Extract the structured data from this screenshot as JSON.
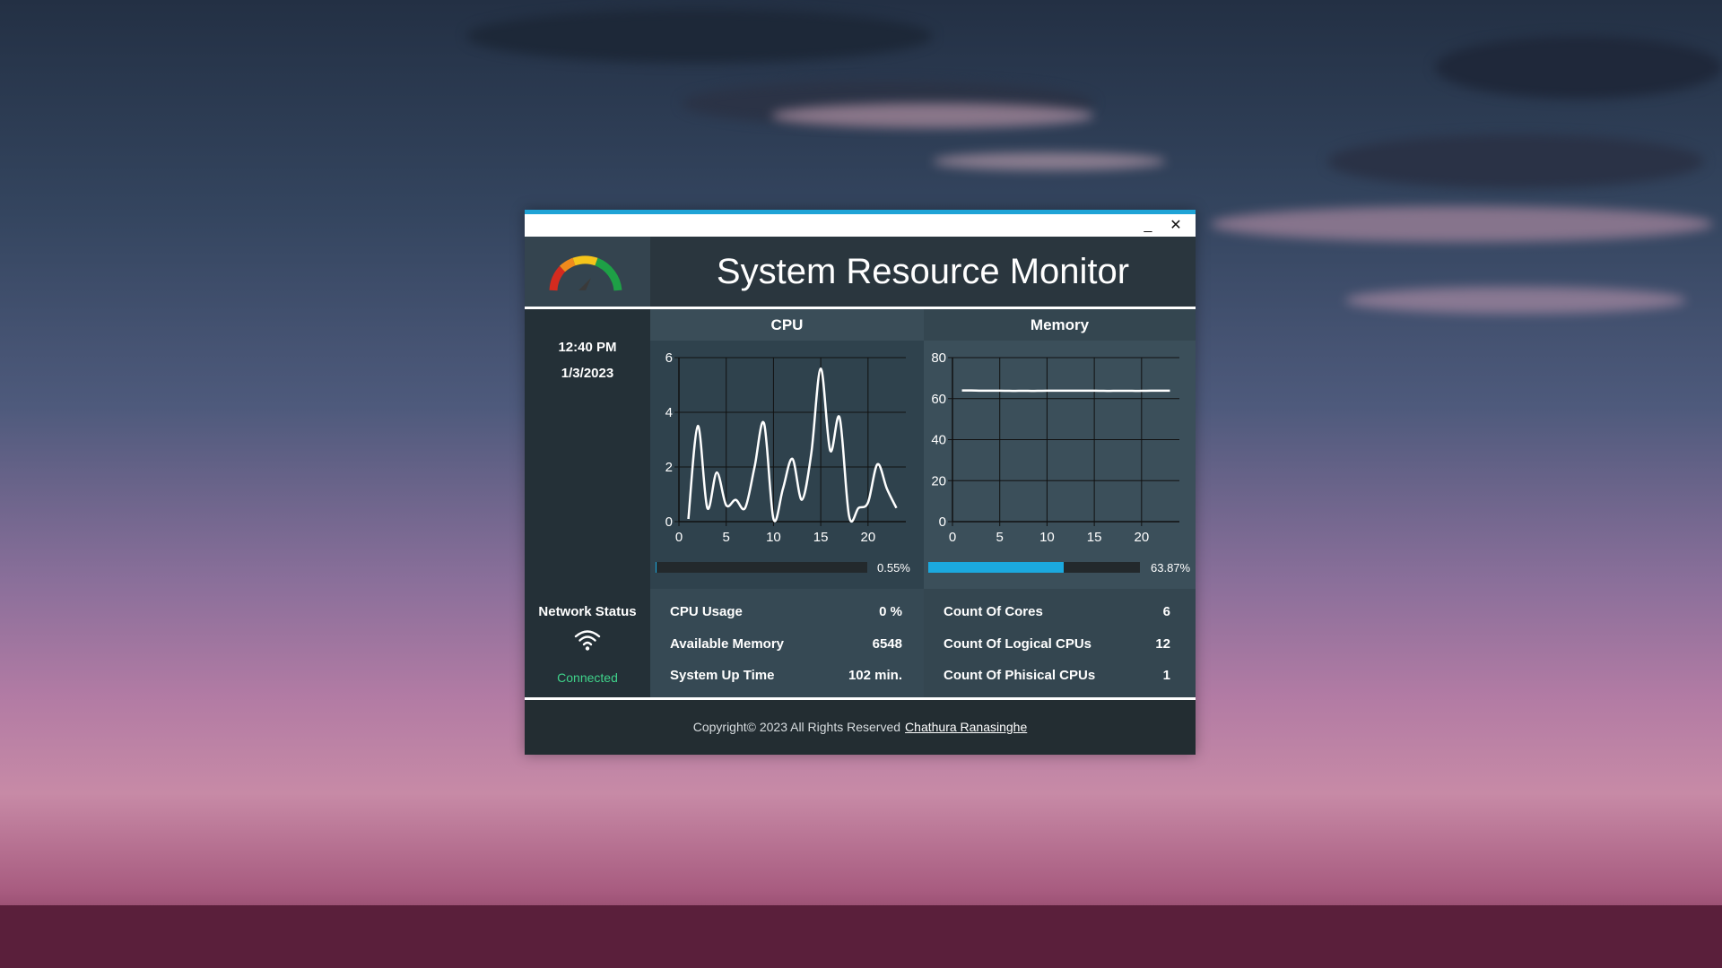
{
  "window": {
    "title": "System Resource Monitor",
    "minimize_label": "_",
    "close_label": "✕"
  },
  "clock": {
    "time": "12:40 PM",
    "date": "1/3/2023"
  },
  "network": {
    "label": "Network Status",
    "status": "Connected",
    "icon": "wifi-icon",
    "status_color": "#3fd28a"
  },
  "cpu": {
    "title": "CPU",
    "percent_label": "0.55%",
    "percent": 0.55,
    "stats": [
      {
        "label": "CPU Usage",
        "value": "0 %"
      },
      {
        "label": "Available Memory",
        "value": "6548"
      },
      {
        "label": "System Up Time",
        "value": "102 min."
      }
    ]
  },
  "memory": {
    "title": "Memory",
    "percent_label": "63.87%",
    "percent": 63.87,
    "stats": [
      {
        "label": "Count Of Cores",
        "value": "6"
      },
      {
        "label": "Count Of Logical CPUs",
        "value": "12"
      },
      {
        "label": "Count Of Phisical CPUs",
        "value": "1"
      }
    ]
  },
  "footer": {
    "copyright": "Copyright© 2023 All Rights Reserved",
    "author": "Chathura Ranasinghe"
  },
  "colors": {
    "accent": "#1fa3d6",
    "progress": "#1ba9df"
  },
  "chart_data": [
    {
      "type": "line",
      "xlim": [
        0,
        24
      ],
      "ylim": [
        0,
        6
      ],
      "xticks": [
        0,
        5,
        10,
        15,
        20
      ],
      "yticks": [
        0,
        2,
        4,
        6
      ],
      "grid": true,
      "x": [
        1,
        2,
        3,
        4,
        5,
        6,
        7,
        8,
        9,
        10,
        11,
        12,
        13,
        14,
        15,
        16,
        17,
        18,
        19,
        20,
        21,
        22,
        23
      ],
      "values": [
        0.1,
        3.5,
        0.5,
        1.8,
        0.6,
        0.8,
        0.5,
        2.0,
        3.6,
        0.1,
        1.2,
        2.3,
        0.8,
        2.5,
        5.6,
        2.6,
        3.8,
        0.2,
        0.5,
        0.7,
        2.1,
        1.2,
        0.5
      ]
    },
    {
      "type": "line",
      "xlim": [
        0,
        24
      ],
      "ylim": [
        0,
        80
      ],
      "xticks": [
        0,
        5,
        10,
        15,
        20
      ],
      "yticks": [
        0,
        20,
        40,
        60,
        80
      ],
      "grid": true,
      "x": [
        1,
        2,
        3,
        4,
        5,
        6,
        7,
        8,
        9,
        10,
        11,
        12,
        13,
        14,
        15,
        16,
        17,
        18,
        19,
        20,
        21,
        22,
        23
      ],
      "values": [
        64,
        64,
        63.9,
        63.9,
        63.9,
        63.8,
        63.8,
        63.8,
        63.8,
        63.9,
        63.9,
        63.9,
        63.9,
        63.9,
        63.9,
        63.8,
        63.8,
        63.8,
        63.8,
        63.8,
        63.9,
        63.9,
        63.9
      ]
    }
  ]
}
